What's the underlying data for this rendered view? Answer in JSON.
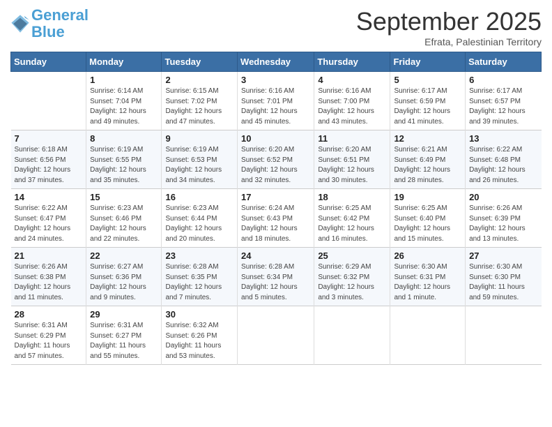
{
  "logo": {
    "line1": "General",
    "line2": "Blue"
  },
  "title": "September 2025",
  "subtitle": "Efrata, Palestinian Territory",
  "days_of_week": [
    "Sunday",
    "Monday",
    "Tuesday",
    "Wednesday",
    "Thursday",
    "Friday",
    "Saturday"
  ],
  "weeks": [
    [
      {
        "num": "",
        "info": ""
      },
      {
        "num": "1",
        "info": "Sunrise: 6:14 AM\nSunset: 7:04 PM\nDaylight: 12 hours\nand 49 minutes."
      },
      {
        "num": "2",
        "info": "Sunrise: 6:15 AM\nSunset: 7:02 PM\nDaylight: 12 hours\nand 47 minutes."
      },
      {
        "num": "3",
        "info": "Sunrise: 6:16 AM\nSunset: 7:01 PM\nDaylight: 12 hours\nand 45 minutes."
      },
      {
        "num": "4",
        "info": "Sunrise: 6:16 AM\nSunset: 7:00 PM\nDaylight: 12 hours\nand 43 minutes."
      },
      {
        "num": "5",
        "info": "Sunrise: 6:17 AM\nSunset: 6:59 PM\nDaylight: 12 hours\nand 41 minutes."
      },
      {
        "num": "6",
        "info": "Sunrise: 6:17 AM\nSunset: 6:57 PM\nDaylight: 12 hours\nand 39 minutes."
      }
    ],
    [
      {
        "num": "7",
        "info": "Sunrise: 6:18 AM\nSunset: 6:56 PM\nDaylight: 12 hours\nand 37 minutes."
      },
      {
        "num": "8",
        "info": "Sunrise: 6:19 AM\nSunset: 6:55 PM\nDaylight: 12 hours\nand 35 minutes."
      },
      {
        "num": "9",
        "info": "Sunrise: 6:19 AM\nSunset: 6:53 PM\nDaylight: 12 hours\nand 34 minutes."
      },
      {
        "num": "10",
        "info": "Sunrise: 6:20 AM\nSunset: 6:52 PM\nDaylight: 12 hours\nand 32 minutes."
      },
      {
        "num": "11",
        "info": "Sunrise: 6:20 AM\nSunset: 6:51 PM\nDaylight: 12 hours\nand 30 minutes."
      },
      {
        "num": "12",
        "info": "Sunrise: 6:21 AM\nSunset: 6:49 PM\nDaylight: 12 hours\nand 28 minutes."
      },
      {
        "num": "13",
        "info": "Sunrise: 6:22 AM\nSunset: 6:48 PM\nDaylight: 12 hours\nand 26 minutes."
      }
    ],
    [
      {
        "num": "14",
        "info": "Sunrise: 6:22 AM\nSunset: 6:47 PM\nDaylight: 12 hours\nand 24 minutes."
      },
      {
        "num": "15",
        "info": "Sunrise: 6:23 AM\nSunset: 6:46 PM\nDaylight: 12 hours\nand 22 minutes."
      },
      {
        "num": "16",
        "info": "Sunrise: 6:23 AM\nSunset: 6:44 PM\nDaylight: 12 hours\nand 20 minutes."
      },
      {
        "num": "17",
        "info": "Sunrise: 6:24 AM\nSunset: 6:43 PM\nDaylight: 12 hours\nand 18 minutes."
      },
      {
        "num": "18",
        "info": "Sunrise: 6:25 AM\nSunset: 6:42 PM\nDaylight: 12 hours\nand 16 minutes."
      },
      {
        "num": "19",
        "info": "Sunrise: 6:25 AM\nSunset: 6:40 PM\nDaylight: 12 hours\nand 15 minutes."
      },
      {
        "num": "20",
        "info": "Sunrise: 6:26 AM\nSunset: 6:39 PM\nDaylight: 12 hours\nand 13 minutes."
      }
    ],
    [
      {
        "num": "21",
        "info": "Sunrise: 6:26 AM\nSunset: 6:38 PM\nDaylight: 12 hours\nand 11 minutes."
      },
      {
        "num": "22",
        "info": "Sunrise: 6:27 AM\nSunset: 6:36 PM\nDaylight: 12 hours\nand 9 minutes."
      },
      {
        "num": "23",
        "info": "Sunrise: 6:28 AM\nSunset: 6:35 PM\nDaylight: 12 hours\nand 7 minutes."
      },
      {
        "num": "24",
        "info": "Sunrise: 6:28 AM\nSunset: 6:34 PM\nDaylight: 12 hours\nand 5 minutes."
      },
      {
        "num": "25",
        "info": "Sunrise: 6:29 AM\nSunset: 6:32 PM\nDaylight: 12 hours\nand 3 minutes."
      },
      {
        "num": "26",
        "info": "Sunrise: 6:30 AM\nSunset: 6:31 PM\nDaylight: 12 hours\nand 1 minute."
      },
      {
        "num": "27",
        "info": "Sunrise: 6:30 AM\nSunset: 6:30 PM\nDaylight: 11 hours\nand 59 minutes."
      }
    ],
    [
      {
        "num": "28",
        "info": "Sunrise: 6:31 AM\nSunset: 6:29 PM\nDaylight: 11 hours\nand 57 minutes."
      },
      {
        "num": "29",
        "info": "Sunrise: 6:31 AM\nSunset: 6:27 PM\nDaylight: 11 hours\nand 55 minutes."
      },
      {
        "num": "30",
        "info": "Sunrise: 6:32 AM\nSunset: 6:26 PM\nDaylight: 11 hours\nand 53 minutes."
      },
      {
        "num": "",
        "info": ""
      },
      {
        "num": "",
        "info": ""
      },
      {
        "num": "",
        "info": ""
      },
      {
        "num": "",
        "info": ""
      }
    ]
  ]
}
